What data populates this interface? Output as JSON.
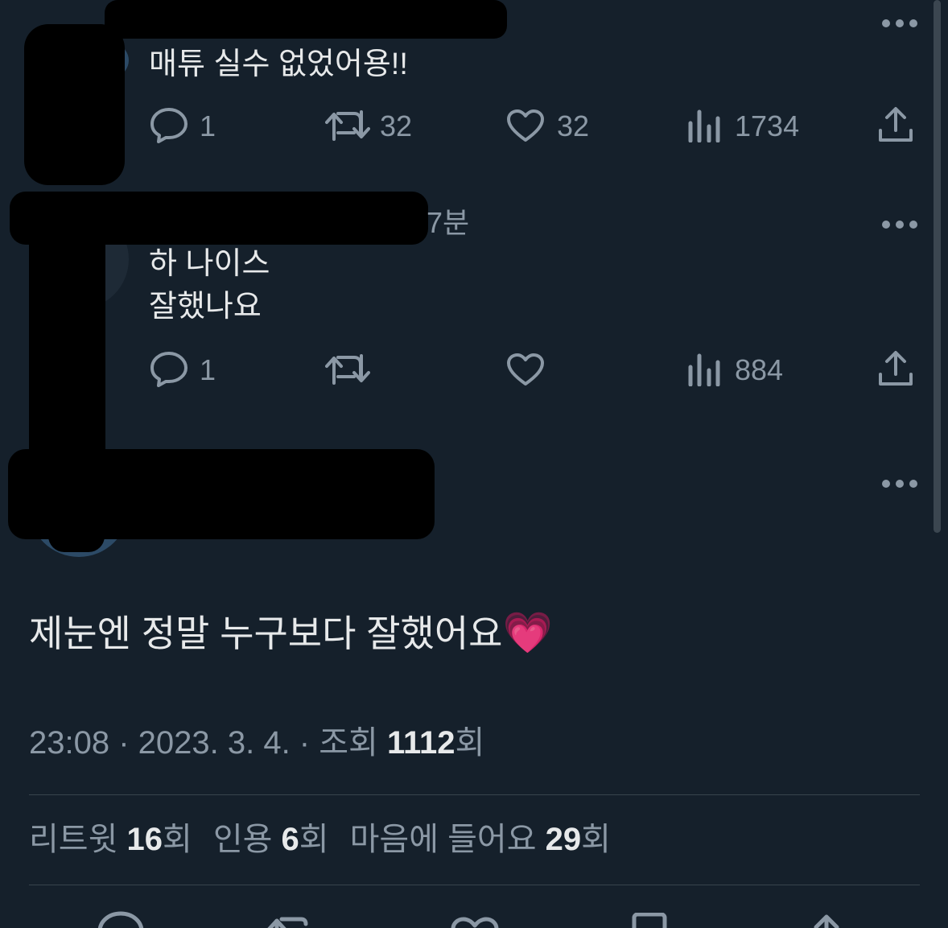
{
  "reply1": {
    "text": "매튜 실수 없었어용!!",
    "replies": "1",
    "retweets": "32",
    "likes": "32",
    "views": "1734"
  },
  "reply2": {
    "time_fragment": "7분",
    "text_line1": "하 나이스",
    "text_line2": "잘했나요",
    "replies": "1",
    "retweets": "",
    "likes": "",
    "views": "884"
  },
  "main_tweet": {
    "text": "제눈엔 정말 누구보다 잘했어요",
    "emoji": "💗",
    "timestamp": "23:08 · 2023. 3. 4. · 조회 ",
    "view_count": "1112",
    "view_suffix": "회"
  },
  "stats": {
    "retweet_label": "리트윗 ",
    "retweet_count": "16",
    "retweet_suffix": "회",
    "quote_label": "인용 ",
    "quote_count": "6",
    "quote_suffix": "회",
    "like_label": "마음에 들어요 ",
    "like_count": "29",
    "like_suffix": "회"
  },
  "colors": {
    "background": "#15202b",
    "text": "#e7e9ea",
    "muted": "#8b98a5",
    "divider": "#38444d"
  }
}
